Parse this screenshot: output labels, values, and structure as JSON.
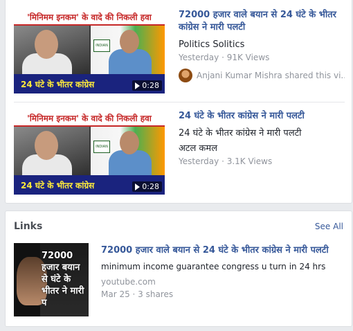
{
  "videos": [
    {
      "thumbnail": {
        "banner": "'मिनिमम इनकम' के वादे की निकली हवा",
        "bottom_caption": "24 घंटे के भीतर कांग्रेस",
        "duration": "0:28"
      },
      "title": "72000 हजार वाले बयान से 24 घंटे के भीतर कांग्रेस ने मारी पलटी",
      "line1": "Politics Solitics",
      "meta": "Yesterday · 91K Views",
      "shared_by": "Anjani Kumar Mishra shared this vi..."
    },
    {
      "thumbnail": {
        "banner": "'मिनिमम इनकम' के वादे की निकली हवा",
        "bottom_caption": "24 घंटे के भीतर कांग्रेस",
        "duration": "0:28"
      },
      "title": "24 घंटे के भीतर कांग्रेस ने मारी पलटी",
      "line1": "24 घंटे के भीतर कांग्रेस ने मारी पलटी",
      "line2": "अटल कमल",
      "meta": "Yesterday · 3.1K Views"
    }
  ],
  "links": {
    "heading": "Links",
    "see_all": "See All",
    "items": [
      {
        "thumbnail_text": "72000 हजार बयान से घंटे के भीतर ने मारी प",
        "title": "72000 हजार वाले बयान से 24 घंटे के भीतर कांग्रेस ने मारी पलटी",
        "description": "minimum income guarantee congress u turn in 24 hrs",
        "source": "youtube.com",
        "meta": "Mar 25 · 3 shares"
      }
    ]
  },
  "colors": {
    "link_blue": "#365899",
    "meta_gray": "#90949c",
    "background": "#e9ebee"
  }
}
